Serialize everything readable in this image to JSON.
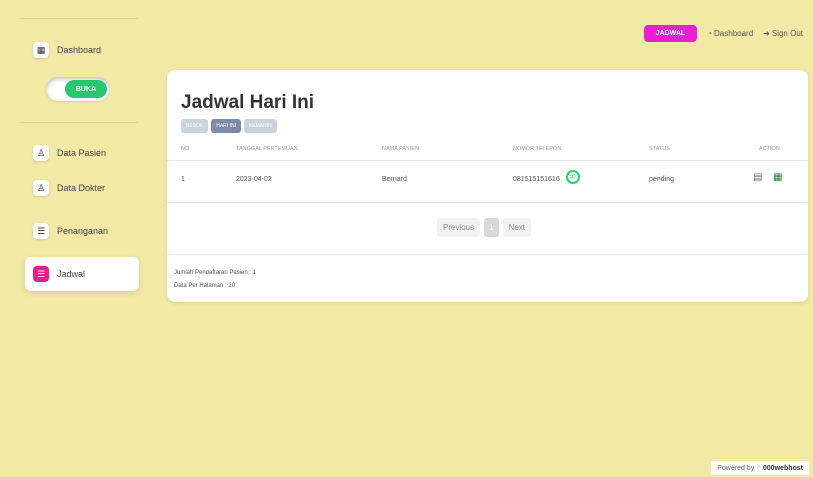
{
  "sidebar": {
    "items": [
      {
        "label": "Dashboard",
        "icon": "building-icon"
      },
      {
        "label": "Data Pasien",
        "icon": "user-plus-icon"
      },
      {
        "label": "Data Dokter",
        "icon": "user-plus-icon"
      },
      {
        "label": "Penanganan",
        "icon": "list-icon"
      },
      {
        "label": "Jadwal",
        "icon": "list-icon"
      }
    ],
    "toggle_label": "BUKA"
  },
  "topnav": {
    "jadwal": "JADWAL",
    "dashboard": "Dashboard",
    "signout": "Sign Out"
  },
  "main": {
    "title": "Jadwal Hari Ini",
    "tabs": [
      "BESOK",
      "HARI INI",
      "KEMARIN"
    ],
    "columns": [
      "NO",
      "TANGGAL PERTEMUAN",
      "NAMA PASIEN",
      "NOMOR TELEPON",
      "STATUS",
      "ACTION"
    ],
    "rows": [
      {
        "no": "1",
        "date": "2023-04-02",
        "name": "Bernard",
        "phone": "081515151616",
        "status": "pending"
      }
    ],
    "pagination": {
      "prev": "Previous",
      "page": "1",
      "next": "Next"
    },
    "info": {
      "count": "Jumlah Pendaftaran Pasien : 1",
      "per_page": "Data Per Halaman : 20"
    }
  },
  "powered": {
    "prefix": "Powered by",
    "brand": "000webhost"
  },
  "colors": {
    "accent": "#e91ed5",
    "active_icon": "#e91e8c",
    "toggle": "#28c76f",
    "background": "#f3e9a6"
  }
}
